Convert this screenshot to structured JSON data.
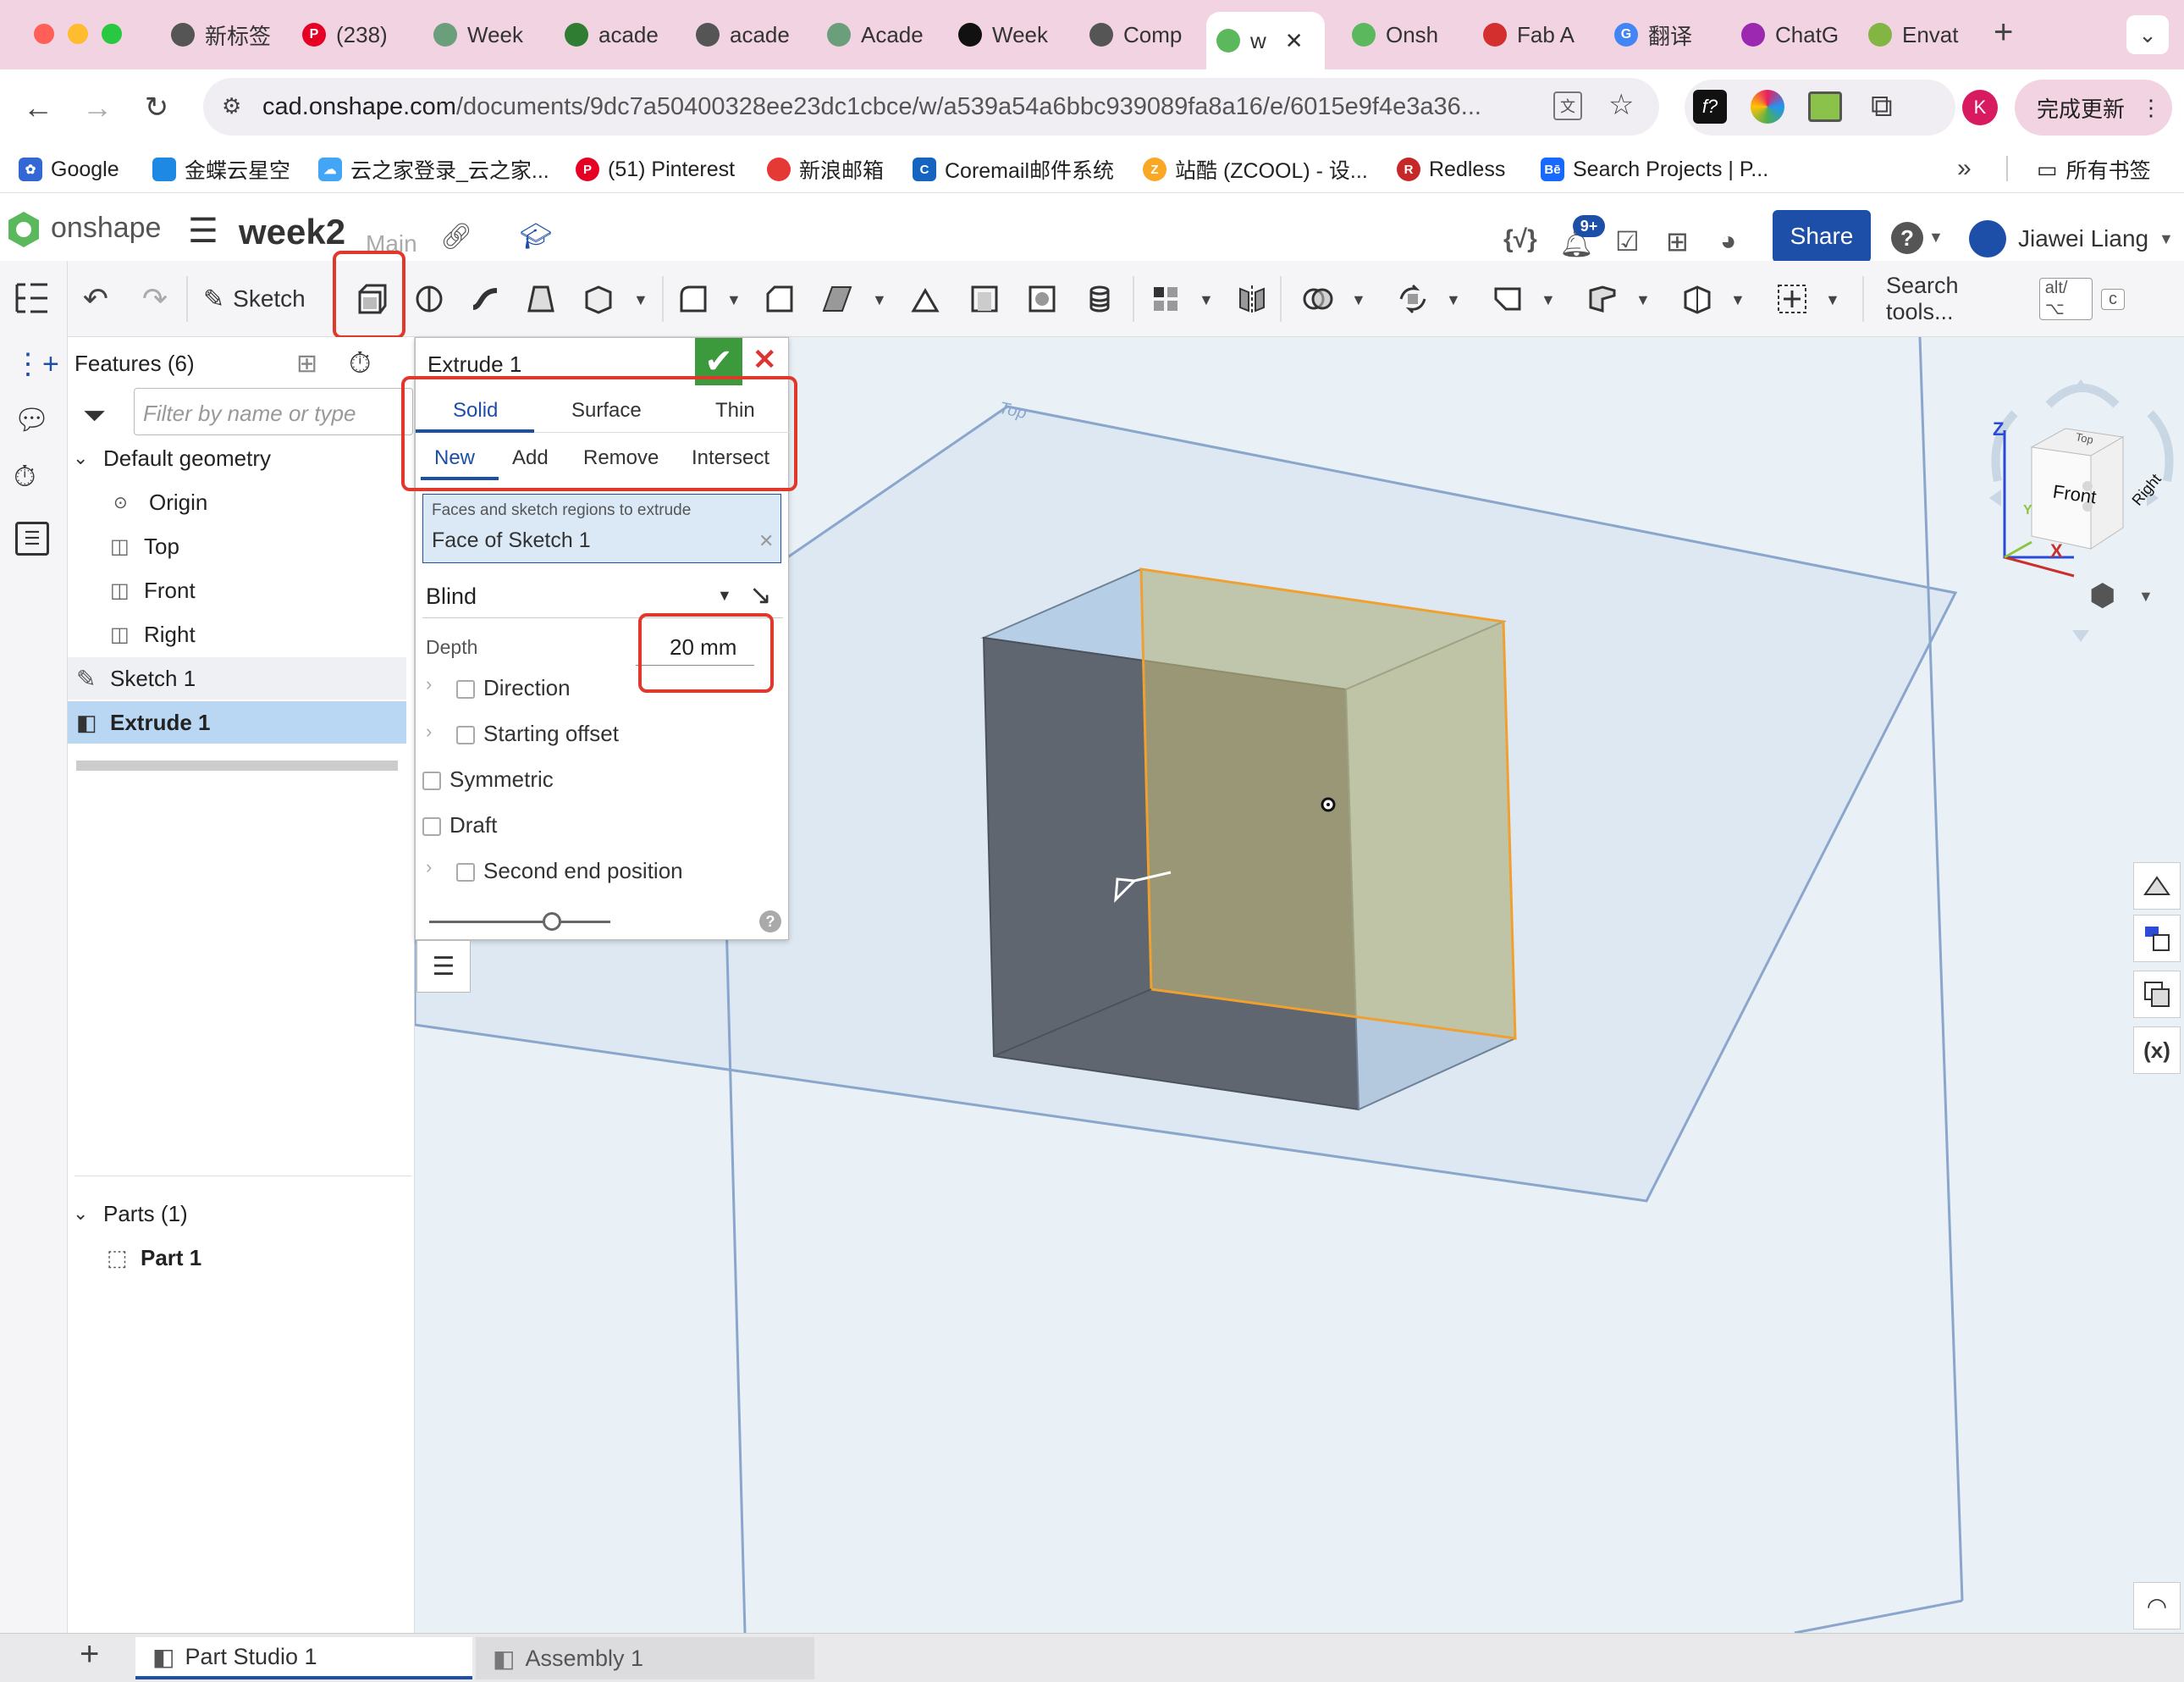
{
  "browser": {
    "tabs": [
      {
        "label": "新标签",
        "color": "#555"
      },
      {
        "label": "(238)",
        "color": "#e60023"
      },
      {
        "label": "Week",
        "color": "#6b9e7a"
      },
      {
        "label": "acade",
        "color": "#2e7d32"
      },
      {
        "label": "acade",
        "color": "#555"
      },
      {
        "label": "Acade",
        "color": "#6b9e7a"
      },
      {
        "label": "Week",
        "color": "#111"
      },
      {
        "label": "Comp",
        "color": "#555"
      },
      {
        "label": "w",
        "color": "#5cb85c"
      },
      {
        "label": "Onsh",
        "color": "#5cb85c"
      },
      {
        "label": "Fab A",
        "color": "#d32f2f"
      },
      {
        "label": "翻译",
        "color": "#4285f4"
      },
      {
        "label": "ChatG",
        "color": "#9c27b0"
      },
      {
        "label": "Envat",
        "color": "#82b541"
      }
    ],
    "url_host": "cad.onshape.com",
    "url_path": "/documents/9dc7a50400328ee23dc1cbce/w/a539a54a6bbc939089fa8a16/e/6015e9f4e3a36...",
    "update_button": "完成更新",
    "profile_initial": "K",
    "bookmarks": [
      {
        "label": "Google",
        "color": "#3367d6"
      },
      {
        "label": "金蝶云星空",
        "color": "#1e88e5"
      },
      {
        "label": "云之家登录_云之家...",
        "color": "#42a5f5"
      },
      {
        "label": "(51) Pinterest",
        "color": "#e60023"
      },
      {
        "label": "新浪邮箱",
        "color": "#e53935"
      },
      {
        "label": "Coremail邮件系统",
        "color": "#1565c0"
      },
      {
        "label": "站酷 (ZCOOL) - 设...",
        "color": "#f9a825"
      },
      {
        "label": "Redless",
        "color": "#c62828"
      },
      {
        "label": "Search Projects | P...",
        "color": "#1769ff"
      }
    ],
    "bookmarks_folder": "所有书签"
  },
  "app": {
    "logo": "onshape",
    "doc_title": "week2",
    "workspace": "Main",
    "notif_badge": "9+",
    "share_label": "Share",
    "help_label": "?",
    "user_name": "Jiawei Liang",
    "brand_color": "#1d4fa8"
  },
  "toolbar": {
    "sketch_label": "Sketch",
    "search_label": "Search tools...",
    "shortcut_1": "alt/⌥",
    "shortcut_2": "c"
  },
  "features": {
    "header": "Features (6)",
    "filter_placeholder": "Filter by name or type",
    "default_geometry": "Default geometry",
    "items": [
      "Origin",
      "Top",
      "Front",
      "Right"
    ],
    "sketch": "Sketch 1",
    "extrude": "Extrude 1",
    "parts_header": "Parts (1)",
    "part": "Part 1"
  },
  "dialog": {
    "title": "Extrude 1",
    "type_tabs": [
      "Solid",
      "Surface",
      "Thin"
    ],
    "op_tabs": [
      "New",
      "Add",
      "Remove",
      "Intersect"
    ],
    "faces_label": "Faces and sketch regions to extrude",
    "faces_value": "Face of Sketch 1",
    "end_type": "Blind",
    "depth_label": "Depth",
    "depth_value": "20 mm",
    "direction_label": "Direction",
    "offset_label": "Starting offset",
    "symmetric_label": "Symmetric",
    "draft_label": "Draft",
    "second_end_label": "Second end position",
    "confirm_color": "#3c9a3c",
    "highlight_color": "#e0392b"
  },
  "viewport": {
    "plane_label": "Top",
    "cube_faces": [
      "Front",
      "Right",
      "Top"
    ],
    "axes": [
      "Z",
      "X",
      "Y"
    ]
  },
  "bottom_tabs": [
    "Part Studio 1",
    "Assembly 1"
  ]
}
